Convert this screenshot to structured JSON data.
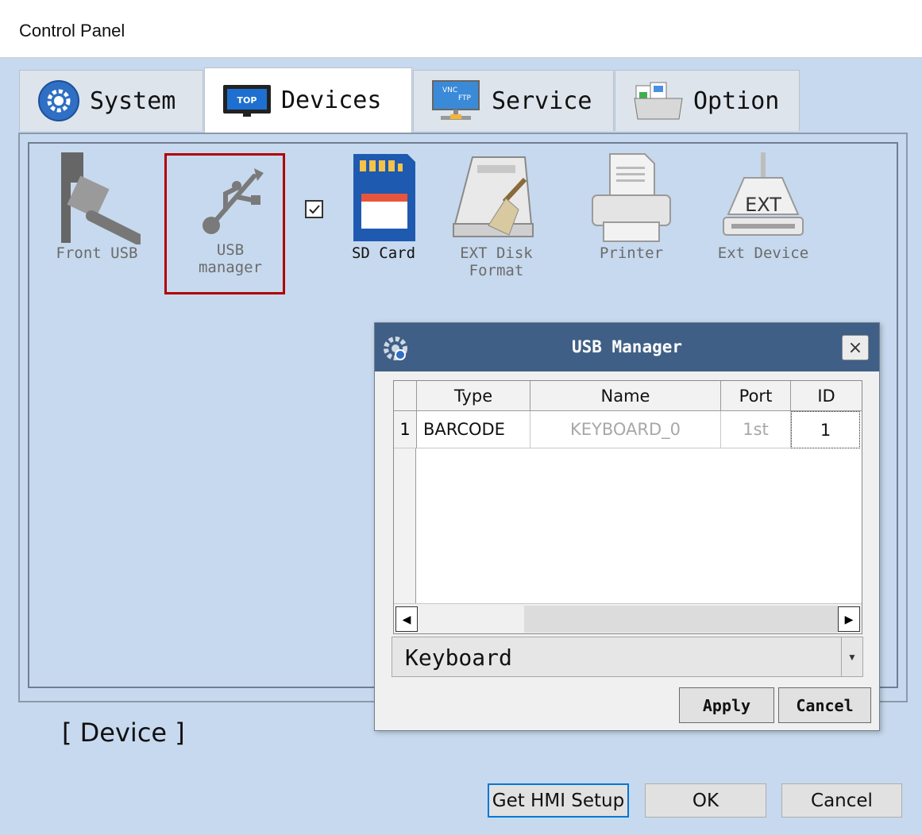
{
  "window": {
    "title": "Control Panel"
  },
  "tabs": [
    {
      "label": "System",
      "icon": "gear-icon"
    },
    {
      "label": "Devices",
      "icon": "top-hmi-icon",
      "active": true
    },
    {
      "label": "Service",
      "icon": "vnc-ftp-icon"
    },
    {
      "label": "Option",
      "icon": "folder-icon"
    }
  ],
  "devices": [
    {
      "label": "Front USB",
      "icon": "front-usb-icon"
    },
    {
      "label_line1": "USB",
      "label_line2": "manager",
      "icon": "usb-icon",
      "checked": true
    },
    {
      "label": "SD Card",
      "icon": "sd-card-icon"
    },
    {
      "label_line1": "EXT Disk",
      "label_line2": "Format",
      "icon": "disk-format-icon"
    },
    {
      "label": "Printer",
      "icon": "printer-icon"
    },
    {
      "label": "Ext Device",
      "icon": "ext-device-icon",
      "badge": "EXT"
    }
  ],
  "section_label": "[ Device ]",
  "buttons": {
    "get_hmi_setup": "Get HMI Setup",
    "ok": "OK",
    "cancel": "Cancel"
  },
  "dialog": {
    "title": "USB Manager",
    "close": "×",
    "columns": [
      "Type",
      "Name",
      "Port",
      "ID"
    ],
    "rows": [
      {
        "num": "1",
        "type": "BARCODE",
        "name": "KEYBOARD_0",
        "port": "1st",
        "id": "1"
      }
    ],
    "dropdown_value": "Keyboard",
    "apply": "Apply",
    "cancel": "Cancel"
  },
  "colors": {
    "background": "#c7d9ee",
    "dialog_title": "#3f5f86",
    "highlight": "#b00000",
    "focus": "#0078d7"
  }
}
